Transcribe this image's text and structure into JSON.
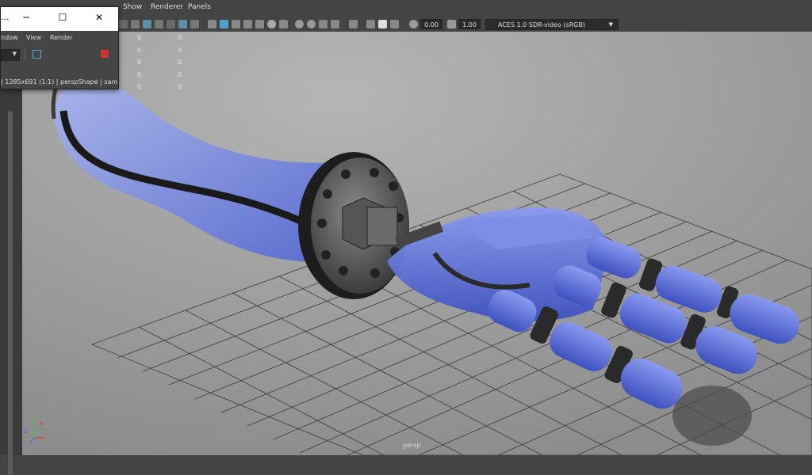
{
  "menubar": {
    "items": [
      {
        "label": "Show"
      },
      {
        "label": "Renderer"
      },
      {
        "label": "Panels"
      }
    ]
  },
  "toolbar": {
    "exposure_value": "0.00",
    "gamma_value": "1.00",
    "color_space": "ACES 1.0 SDR-video (sRGB)"
  },
  "viewport": {
    "camera_label": "persp",
    "hud_column_1": [
      "0",
      "0",
      "0",
      "0",
      "0"
    ],
    "hud_column_2": [
      "0",
      "0",
      "0",
      "0",
      "0"
    ],
    "axis_labels": {
      "x": "x",
      "y": "y",
      "z": "z"
    }
  },
  "render_window": {
    "title_fragment": "...",
    "menu": [
      "ndow",
      "View",
      "Render"
    ],
    "status": "| 1285x691 (1:1) | perspShape | sam"
  },
  "colors": {
    "viewport_bg": "#9b9b9b",
    "grid": "#3a3a3a",
    "hand_blue": "#5a6fd6",
    "metal": "#4a4a4a"
  }
}
